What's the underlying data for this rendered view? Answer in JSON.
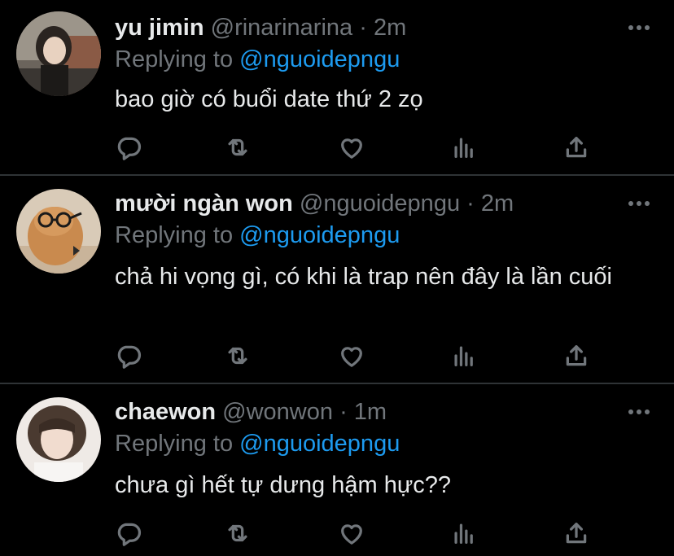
{
  "tweets": [
    {
      "name": "yu jimin",
      "handle": "@rinarinarina",
      "time": "2m",
      "replying_prefix": "Replying to",
      "replying_to": "@nguoidepngu",
      "text": "bao giờ có buổi date thứ 2 zọ"
    },
    {
      "name": "mười ngàn won",
      "handle": "@nguoidepngu",
      "time": "2m",
      "replying_prefix": "Replying to",
      "replying_to": "@nguoidepngu",
      "text": "chả hi vọng gì, có khi là trap nên đây là lần cuối"
    },
    {
      "name": "chaewon",
      "handle": "@wonwon",
      "time": "1m",
      "replying_prefix": "Replying to",
      "replying_to": "@nguoidepngu",
      "text": "chưa gì hết tự dưng hậm hực??"
    }
  ],
  "separator": "·",
  "icons": [
    "reply-icon",
    "retweet-icon",
    "like-icon",
    "stats-icon",
    "share-icon",
    "more-icon"
  ],
  "colors": {
    "background": "#000000",
    "text": "#e7e9ea",
    "secondary": "#71767b",
    "mention": "#1d9bf0",
    "divider": "#2f3336"
  }
}
